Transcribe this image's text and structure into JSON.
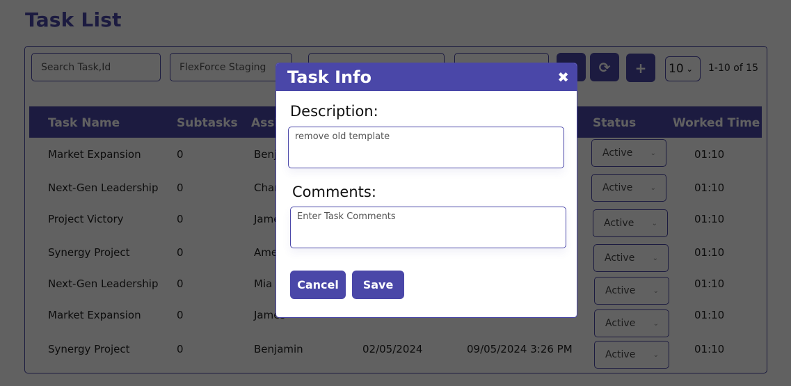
{
  "page": {
    "title": "Task List"
  },
  "toolbar": {
    "search_placeholder": "Search Task,Id",
    "project_value": "FlexForce Staging",
    "field3_value": "",
    "field4_value": "",
    "buttons": [
      {
        "name": "filter",
        "icon": "circle-icon"
      },
      {
        "name": "refresh",
        "icon": "refresh-icon",
        "glyph": "⟳"
      },
      {
        "name": "add",
        "icon": "plus-icon",
        "glyph": "+"
      }
    ],
    "per_page": "10",
    "pagination": "1-10 of 15"
  },
  "table": {
    "columns": [
      "Task Name",
      "Subtasks",
      "Assi",
      "",
      "",
      "Status",
      "Worked Time"
    ],
    "rows": [
      {
        "task": "Market Expansion",
        "subtasks": "0",
        "assignee": "Benj",
        "start": "",
        "end": "",
        "status": "Active",
        "worked": "01:10"
      },
      {
        "task": "Next-Gen Leadership",
        "subtasks": "0",
        "assignee": "Char",
        "start": "",
        "end": "",
        "status": "Active",
        "worked": "01:10"
      },
      {
        "task": "Project Victory",
        "subtasks": "0",
        "assignee": "Jame",
        "start": "",
        "end": "",
        "status": "Active",
        "worked": "01:10"
      },
      {
        "task": "Synergy Project",
        "subtasks": "0",
        "assignee": "Ame",
        "start": "",
        "end": "",
        "status": "Active",
        "worked": "01:10"
      },
      {
        "task": "Next-Gen Leadership",
        "subtasks": "0",
        "assignee": "Mia",
        "start": "",
        "end": "",
        "status": "Active",
        "worked": "01:10"
      },
      {
        "task": "Market Expansion",
        "subtasks": "0",
        "assignee": "James",
        "start": "",
        "end": "",
        "status": "Active",
        "worked": "01:10"
      },
      {
        "task": "Synergy Project",
        "subtasks": "0",
        "assignee": "Benjamin",
        "start": "02/05/2024",
        "end": "09/05/2024 3:26 PM",
        "status": "Active",
        "worked": "01:10"
      }
    ]
  },
  "modal": {
    "title": "Task Info",
    "close_glyph": "✖",
    "description_label": "Description:",
    "description_value": "remove old template",
    "comments_label": "Comments:",
    "comments_placeholder": "Enter Task Comments",
    "cancel_label": "Cancel",
    "save_label": "Save"
  },
  "colors": {
    "accent": "#4a47a8",
    "overlay": "rgba(0,0,0,0.62)"
  }
}
